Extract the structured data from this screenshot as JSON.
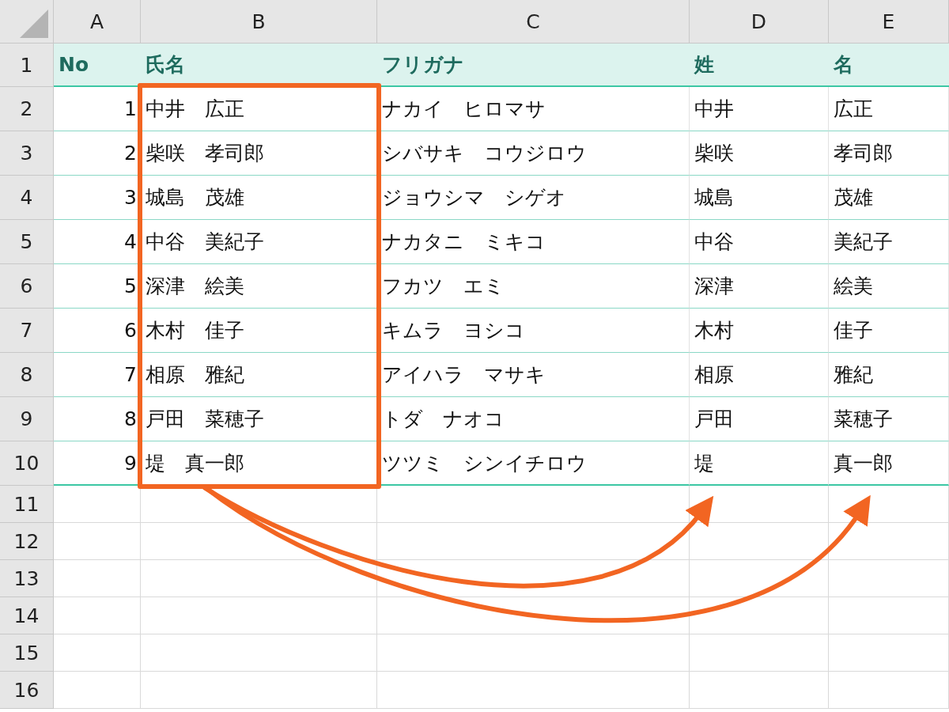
{
  "columns": [
    "A",
    "B",
    "C",
    "D",
    "E"
  ],
  "header_row": {
    "number": "1",
    "cells": [
      "No",
      "氏名",
      "フリガナ",
      "姓",
      "名"
    ]
  },
  "rows": [
    {
      "number": "2",
      "cells": [
        "1",
        "中井　広正",
        "ナカイ　ヒロマサ",
        "中井",
        "広正"
      ]
    },
    {
      "number": "3",
      "cells": [
        "2",
        "柴咲　孝司郎",
        "シバサキ　コウジロウ",
        "柴咲",
        "孝司郎"
      ]
    },
    {
      "number": "4",
      "cells": [
        "3",
        "城島　茂雄",
        "ジョウシマ　シゲオ",
        "城島",
        "茂雄"
      ]
    },
    {
      "number": "5",
      "cells": [
        "4",
        "中谷　美紀子",
        "ナカタニ　ミキコ",
        "中谷",
        "美紀子"
      ]
    },
    {
      "number": "6",
      "cells": [
        "5",
        "深津　絵美",
        "フカツ　エミ",
        "深津",
        "絵美"
      ]
    },
    {
      "number": "7",
      "cells": [
        "6",
        "木村　佳子",
        "キムラ　ヨシコ",
        "木村",
        "佳子"
      ]
    },
    {
      "number": "8",
      "cells": [
        "7",
        "相原　雅紀",
        "アイハラ　マサキ",
        "相原",
        "雅紀"
      ]
    },
    {
      "number": "9",
      "cells": [
        "8",
        "戸田　菜穂子",
        "トダ　ナオコ",
        "戸田",
        "菜穂子"
      ]
    },
    {
      "number": "10",
      "cells": [
        "9",
        "堤　真一郎",
        "ツツミ　シンイチロウ",
        "堤",
        "真一郎"
      ]
    }
  ],
  "empty_rows": [
    "11",
    "12",
    "13",
    "14",
    "15",
    "16"
  ]
}
